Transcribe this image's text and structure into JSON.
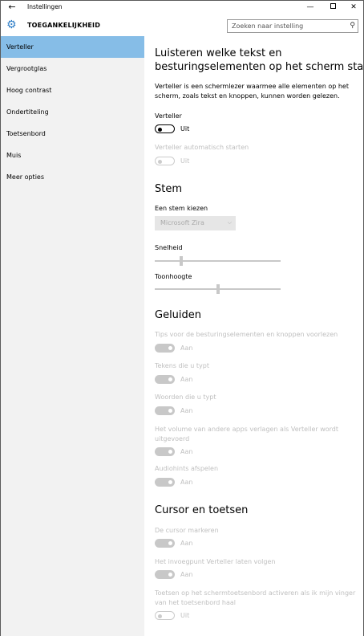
{
  "window": {
    "title": "Instellingen",
    "back_icon": "arrow-left-icon",
    "min_glyph": "—",
    "close_glyph": "✕"
  },
  "header": {
    "section_title": "TOEGANKELIJKHEID",
    "search_placeholder": "Zoeken naar instelling",
    "accent": "#2b7bc5"
  },
  "sidebar": {
    "items": [
      {
        "label": "Verteller",
        "active": true
      },
      {
        "label": "Vergrootglas"
      },
      {
        "label": "Hoog contrast"
      },
      {
        "label": "Ondertiteling"
      },
      {
        "label": "Toetsenbord"
      },
      {
        "label": "Muis"
      },
      {
        "label": "Meer opties"
      }
    ],
    "active_color": "#86bde7"
  },
  "main": {
    "heading": [
      "Luisteren welke tekst en",
      "besturingselementen op het scherm staan"
    ],
    "intro": [
      "Verteller is een schermlezer waarmee alle elementen op het",
      "scherm, zoals tekst en knoppen, kunnen worden gelezen."
    ],
    "verteller": {
      "label": "Verteller",
      "state": "Uit"
    },
    "auto_start": {
      "label": "Verteller automatisch starten",
      "state": "Uit"
    },
    "stem": {
      "heading": "Stem",
      "voice_label": "Een stem kiezen",
      "voice_value": "Microsoft Zira",
      "speed_label": "Snelheid",
      "speed_value": 0.2,
      "pitch_label": "Toonhoogte",
      "pitch_value": 0.5
    },
    "geluiden": {
      "heading": "Geluiden",
      "items": [
        {
          "label": "Tips voor de besturingselementen en knoppen voorlezen",
          "state": "Aan"
        },
        {
          "label": "Tekens die u typt",
          "state": "Aan"
        },
        {
          "label": "Woorden die u typt",
          "state": "Aan"
        },
        {
          "label": [
            "Het volume van andere apps verlagen als Verteller wordt",
            "uitgevoerd"
          ],
          "state": "Aan"
        },
        {
          "label": "Audiohints afspelen",
          "state": "Aan"
        }
      ]
    },
    "cursor": {
      "heading": "Cursor en toetsen",
      "items": [
        {
          "label": "De cursor markeren",
          "state": "Aan"
        },
        {
          "label": "Het invoegpunt Verteller laten volgen",
          "state": "Aan"
        },
        {
          "label": [
            "Toetsen op het schermtoetsenbord activeren als ik mijn vinger",
            "van het toetsenbord haal"
          ],
          "state": "Uit"
        }
      ]
    }
  }
}
